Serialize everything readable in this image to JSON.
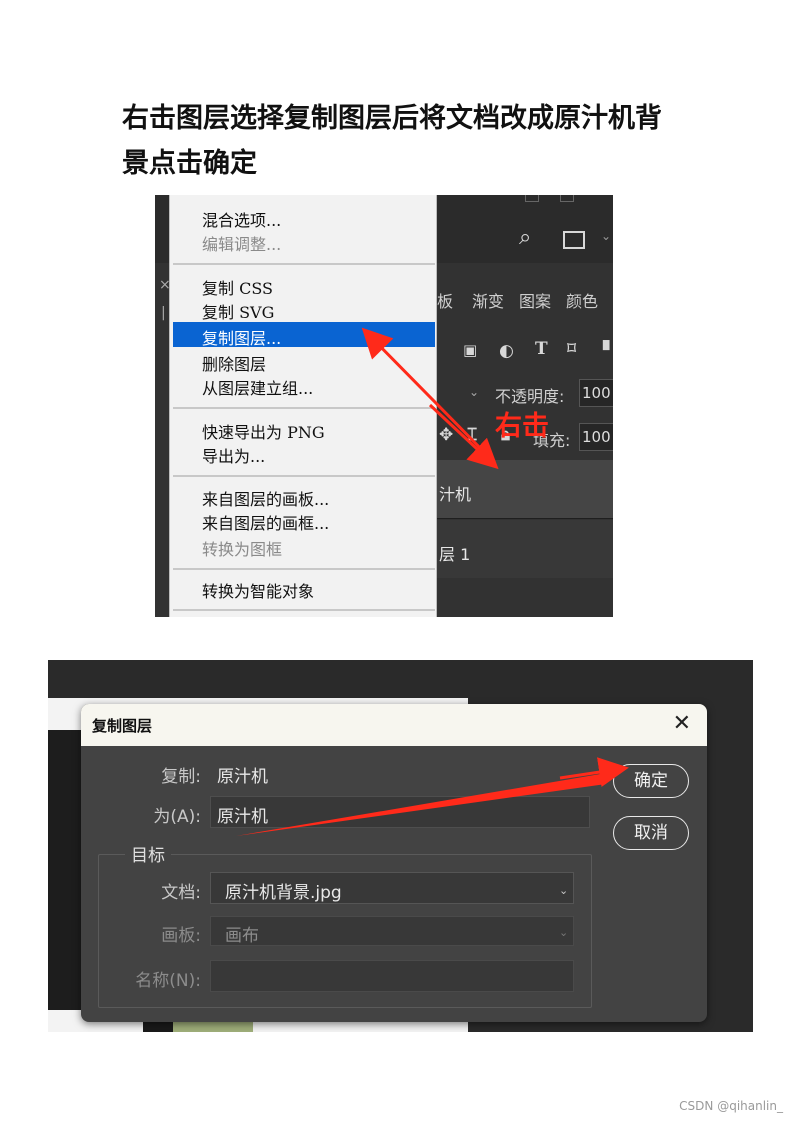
{
  "heading": "右击图层选择复制图层后将文档改成原汁机背景点击确定",
  "screenshot1": {
    "context_menu": {
      "groups": [
        [
          "混合选项...",
          "编辑调整..."
        ],
        [
          "复制 CSS",
          "复制 SVG",
          "复制图层...",
          "删除图层",
          "从图层建立组..."
        ],
        [
          "快速导出为 PNG",
          "导出为..."
        ],
        [
          "来自图层的画板...",
          "来自图层的画框...",
          "转换为图框"
        ],
        [
          "转换为智能对象"
        ]
      ],
      "highlighted": "复制图层...",
      "disabled": [
        "编辑调整...",
        "转换为图框"
      ]
    },
    "panel_tabs": [
      "板",
      "渐变",
      "图案",
      "颜色"
    ],
    "opacity_label": "不透明度:",
    "opacity_value": "100",
    "fill_label": "填充:",
    "fill_value": "100",
    "layers": [
      "汁机",
      "层 1"
    ],
    "annotation": "右击"
  },
  "screenshot2": {
    "dialog_title": "复制图层",
    "duplicate_label": "复制:",
    "duplicate_value": "原汁机",
    "as_label": "为(A):",
    "as_value": "原汁机",
    "destination_label": "目标",
    "document_label": "文档:",
    "document_value": "原汁机背景.jpg",
    "artboard_label": "画板:",
    "artboard_value": "画布",
    "name_label": "名称(N):",
    "name_value": "",
    "ok_button": "确定",
    "cancel_button": "取消"
  },
  "watermark": "CSDN @qihanlin_",
  "colors": {
    "highlight": "#0a64d2",
    "annotation_red": "#ff2a1a"
  }
}
